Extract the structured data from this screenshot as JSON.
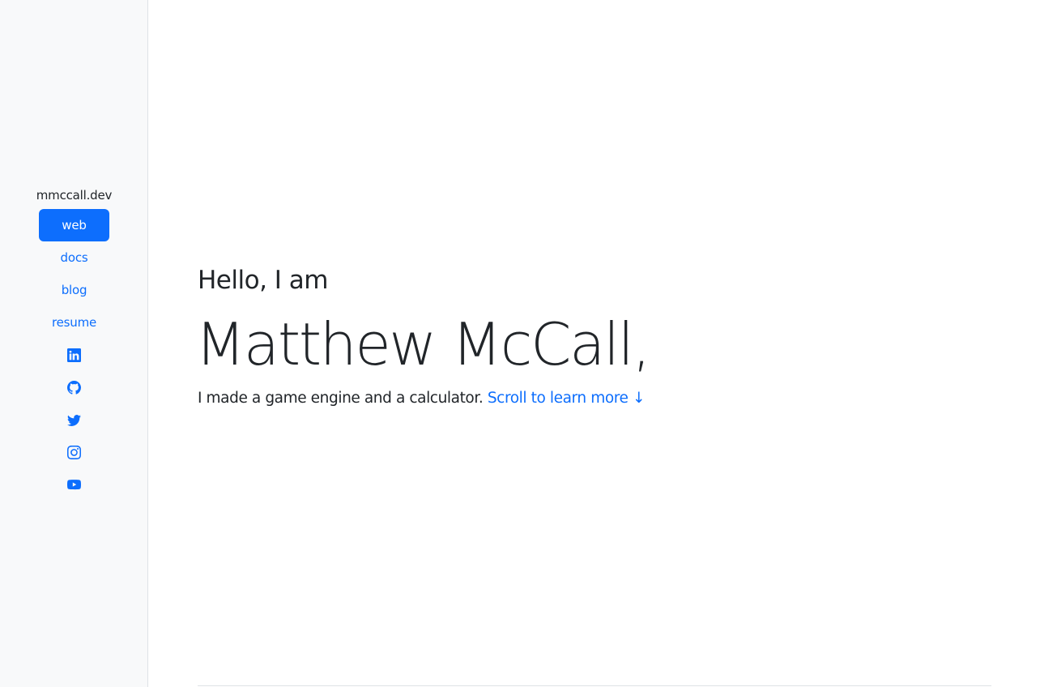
{
  "sidebar": {
    "brand": "mmccall.dev",
    "nav": [
      {
        "label": "web",
        "active": true
      },
      {
        "label": "docs",
        "active": false
      },
      {
        "label": "blog",
        "active": false
      },
      {
        "label": "resume",
        "active": false
      }
    ],
    "social_icons": [
      "linkedin-icon",
      "github-icon",
      "twitter-icon",
      "instagram-icon",
      "youtube-icon"
    ]
  },
  "hero": {
    "greeting": "Hello, I am",
    "name": "Matthew McCall,",
    "tagline": "I made a game engine and a calculator.",
    "scroll_link": "Scroll to learn more ↓"
  },
  "colors": {
    "accent": "#0d6efd",
    "sidebar_bg": "#f8f9fa",
    "text": "#212529"
  }
}
